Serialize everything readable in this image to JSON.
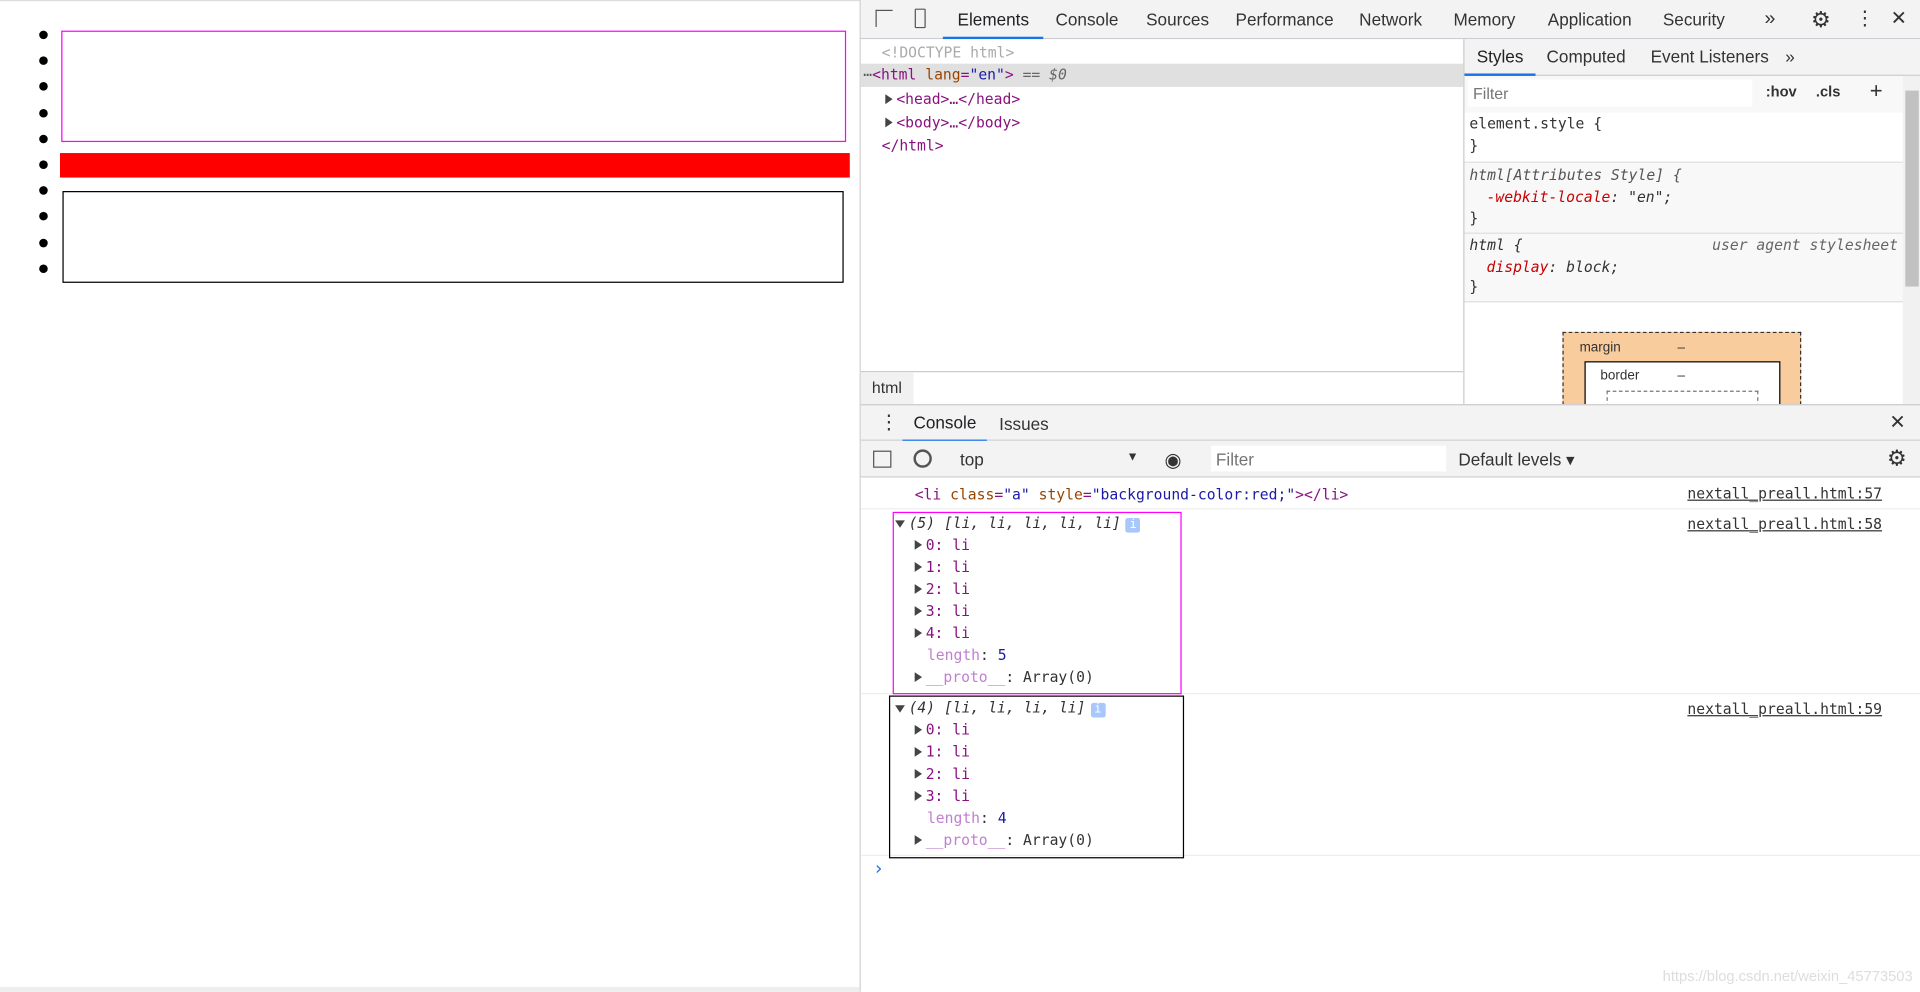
{
  "page": {
    "bullet_count": 10,
    "boxes": {
      "magenta_border": "#ff00ff",
      "red_fill": "#ff0000",
      "black_border": "#000000"
    }
  },
  "devtools": {
    "tabs": [
      "Elements",
      "Console",
      "Sources",
      "Performance",
      "Network",
      "Memory",
      "Application",
      "Security"
    ],
    "active_tab": "Elements",
    "more": "»",
    "elements": {
      "doctype": "<!DOCTYPE html>",
      "html_open": "<html",
      "lang_attr": "lang",
      "lang_val": "\"en\"",
      "html_close_bracket": ">",
      "selected_marker": "== $0",
      "head": "<head>…</head>",
      "body": "<body>…</body>",
      "html_end": "</html>",
      "breadcrumb": "html"
    },
    "styles": {
      "tabs": [
        "Styles",
        "Computed",
        "Event Listeners"
      ],
      "more": "»",
      "filter_placeholder": "Filter",
      "hov": ":hov",
      "cls": ".cls",
      "add": "+",
      "rules": [
        {
          "selector": "element.style {",
          "props": [],
          "close": "}"
        },
        {
          "selector": "html[Attributes Style] {",
          "props": [
            {
              "name": "-webkit-locale",
              "value": "\"en\";"
            }
          ],
          "close": "}"
        },
        {
          "selector": "html {",
          "source": "user agent stylesheet",
          "props": [
            {
              "name": "display",
              "value": "block;"
            }
          ],
          "close": "}"
        }
      ],
      "boxmodel": {
        "margin": "margin",
        "margin_val": "–",
        "border": "border",
        "border_val": "–"
      }
    },
    "drawer": {
      "tabs": [
        "Console",
        "Issues"
      ],
      "context": "top",
      "filter_placeholder": "Filter",
      "levels": "Default levels ▾"
    },
    "console": {
      "msg1": {
        "text_tag": "<li",
        "cls_attr": "class",
        "cls_val": "\"a\"",
        "style_attr": "style",
        "style_val": "\"background-color:red;\"",
        "end": "></li>",
        "source": "nextall_preall.html:57"
      },
      "msg2": {
        "header": "(5) [li, li, li, li, li]",
        "items": [
          "0: li",
          "1: li",
          "2: li",
          "3: li",
          "4: li"
        ],
        "length_key": "length",
        "length": "5",
        "proto": "__proto__",
        "proto_val": ": Array(0)",
        "source": "nextall_preall.html:58"
      },
      "msg3": {
        "header": "(4) [li, li, li, li]",
        "items": [
          "0: li",
          "1: li",
          "2: li",
          "3: li"
        ],
        "length_key": "length",
        "length": "4",
        "proto": "__proto__",
        "proto_val": ": Array(0)",
        "source": "nextall_preall.html:59"
      },
      "prompt": "›"
    }
  },
  "watermark": "https://blog.csdn.net/weixin_45773503"
}
